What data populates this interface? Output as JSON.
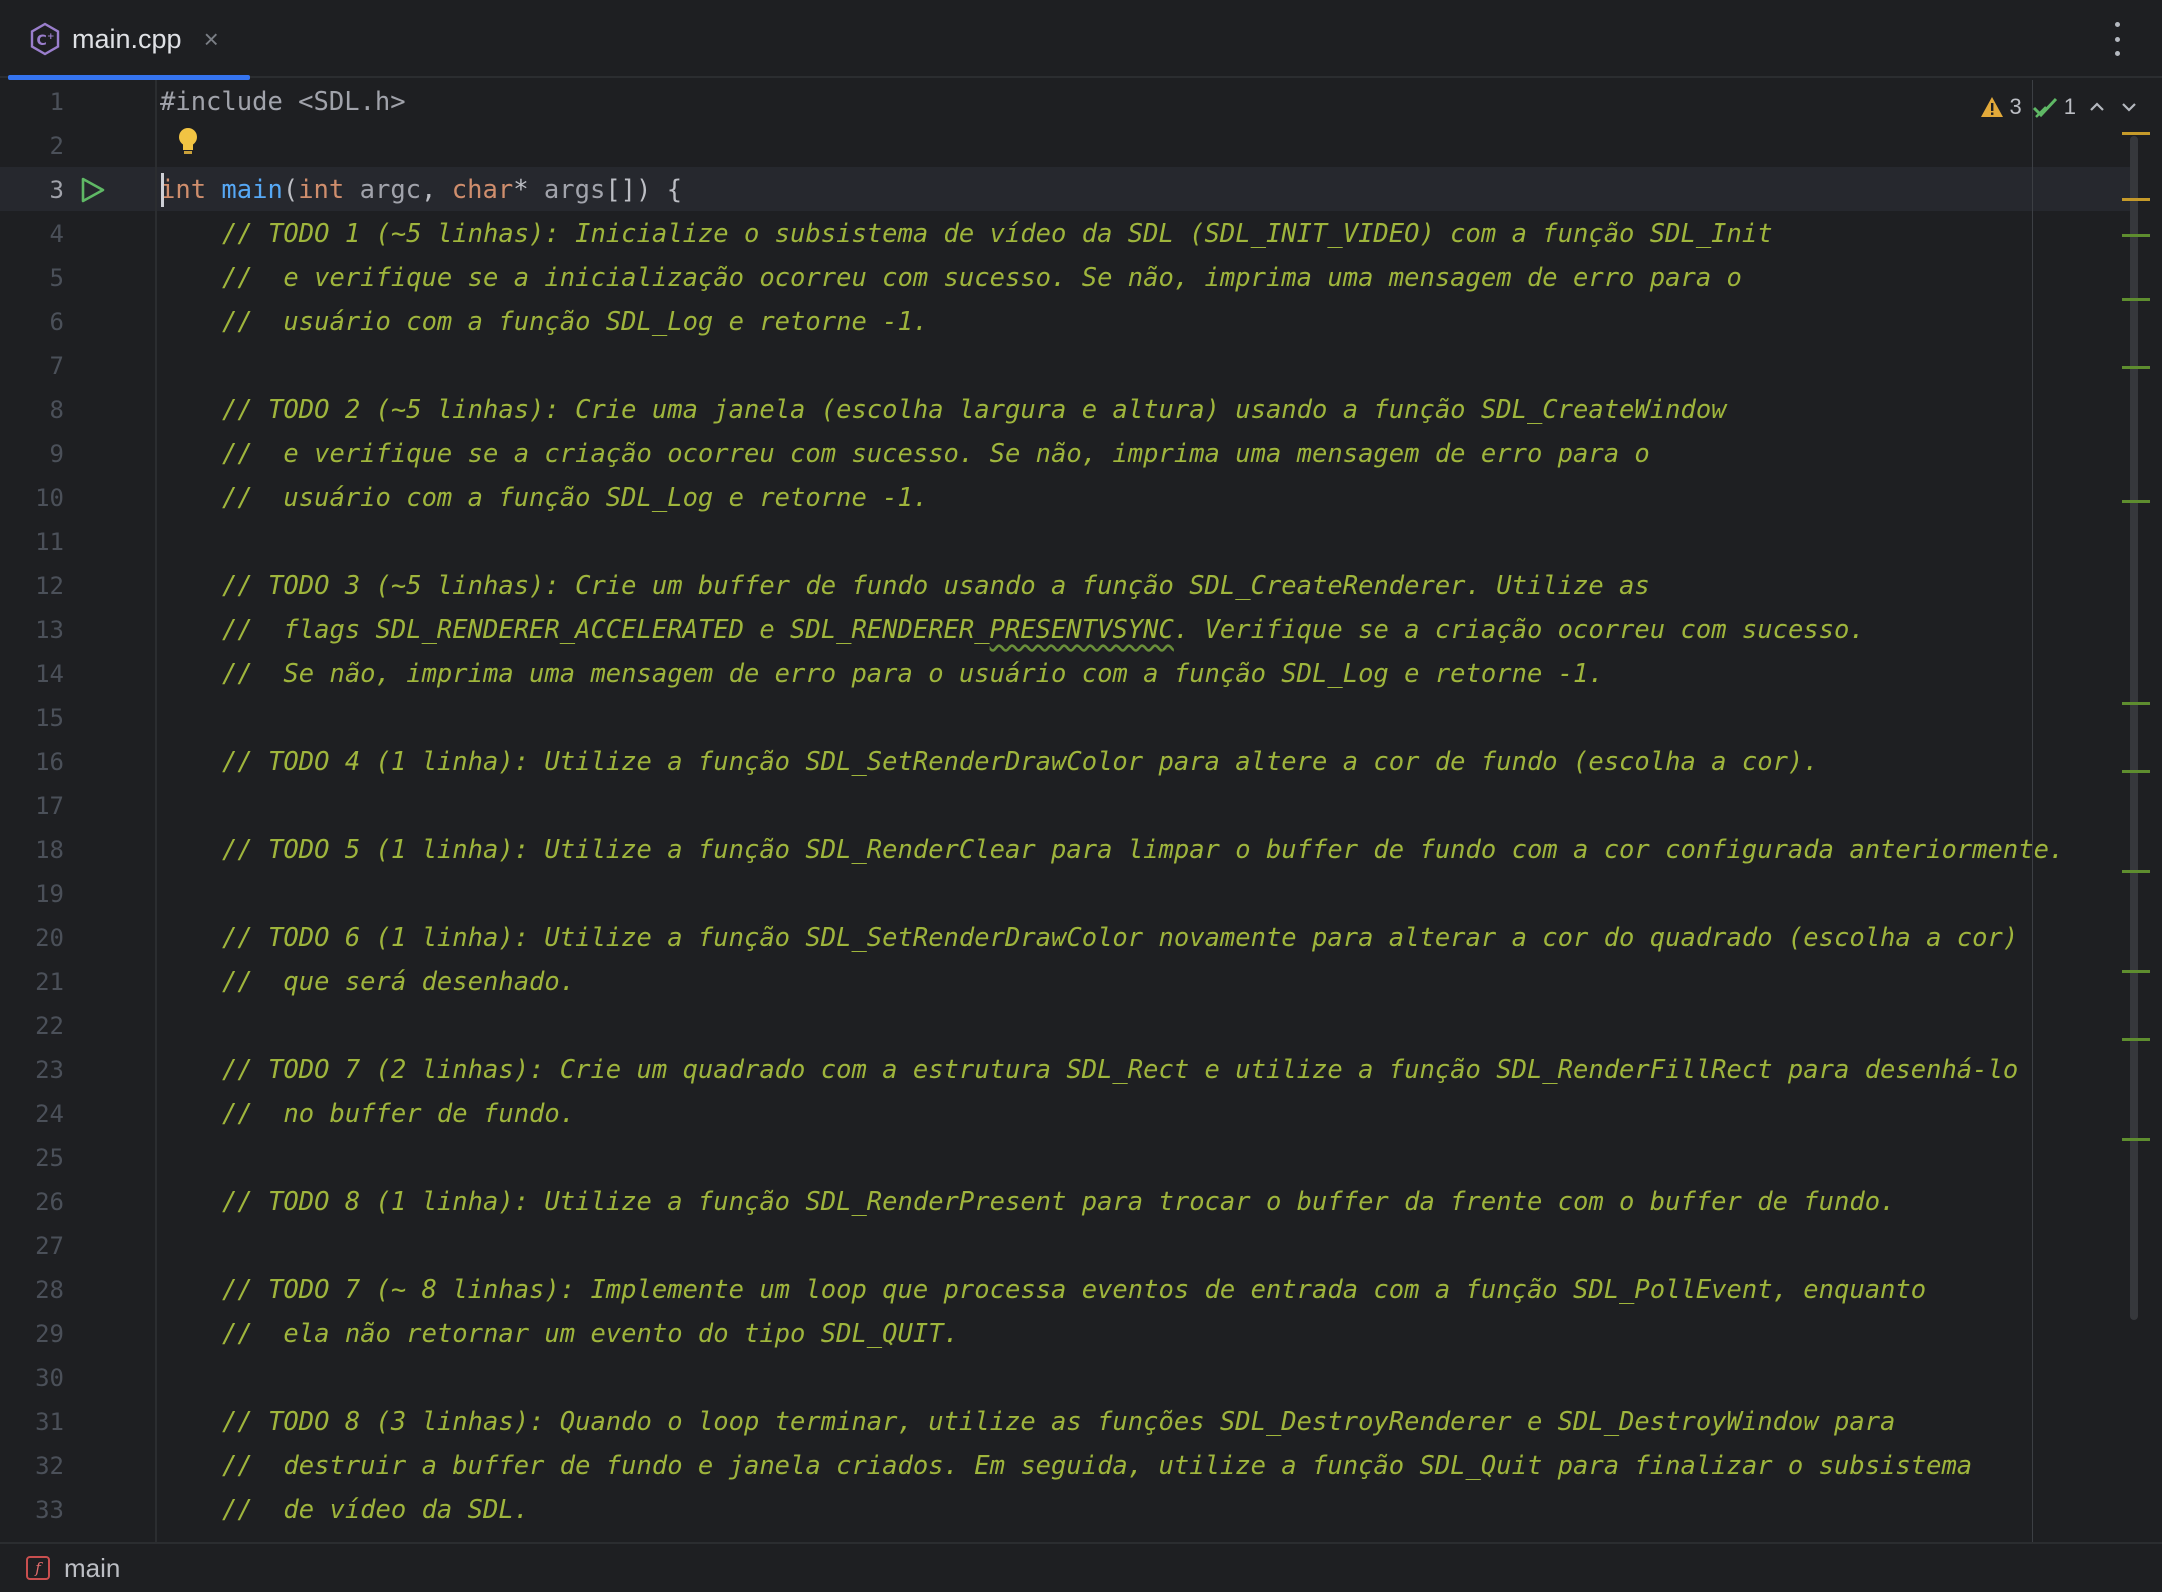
{
  "tab": {
    "filename": "main.cpp",
    "close": "×"
  },
  "inspections": {
    "warnings": "3",
    "weak_warnings": "1"
  },
  "code": {
    "l1": "#include <SDL.h>",
    "l3": {
      "kw_int": "int",
      "fn_main": "main",
      "paren_open": "(",
      "kw_int2": "int",
      "p_argc": "argc",
      "comma": ", ",
      "kw_char": "char",
      "star": "* ",
      "p_args": "args",
      "rest": "[]) {"
    },
    "l4": "// TODO 1 (~5 linhas): Inicialize o subsistema de vídeo da SDL (SDL_INIT_VIDEO) com a função SDL_Init",
    "l5": "//  e verifique se a inicialização ocorreu com sucesso. Se não, imprima uma mensagem de erro para o",
    "l6": "//  usuário com a função SDL_Log e retorne -1.",
    "l8": "// TODO 2 (~5 linhas): Crie uma janela (escolha largura e altura) usando a função SDL_CreateWindow",
    "l9": "//  e verifique se a criação ocorreu com sucesso. Se não, imprima uma mensagem de erro para o",
    "l10": "//  usuário com a função SDL_Log e retorne -1.",
    "l12": "// TODO 3 (~5 linhas): Crie um buffer de fundo usando a função SDL_CreateRenderer. Utilize as",
    "l13a": "//  flags SDL_RENDERER_ACCELERATED e SDL_RENDERER_",
    "l13b": "PRESENTVSYNC",
    "l13c": ". Verifique se a criação ocorreu com sucesso.",
    "l14": "//  Se não, imprima uma mensagem de erro para o usuário com a função SDL_Log e retorne -1.",
    "l16": "// TODO 4 (1 linha): Utilize a função SDL_SetRenderDrawColor para altere a cor de fundo (escolha a cor).",
    "l18": "// TODO 5 (1 linha): Utilize a função SDL_RenderClear para limpar o buffer de fundo com a cor configurada anteriormente.",
    "l20": "// TODO 6 (1 linha): Utilize a função SDL_SetRenderDrawColor novamente para alterar a cor do quadrado (escolha a cor)",
    "l21": "//  que será desenhado.",
    "l23": "// TODO 7 (2 linhas): Crie um quadrado com a estrutura SDL_Rect e utilize a função SDL_RenderFillRect para desenhá-lo",
    "l24": "//  no buffer de fundo.",
    "l26": "// TODO 8 (1 linha): Utilize a função SDL_RenderPresent para trocar o buffer da frente com o buffer de fundo.",
    "l28": "// TODO 7 (~ 8 linhas): Implemente um loop que processa eventos de entrada com a função SDL_PollEvent, enquanto",
    "l29": "//  ela não retornar um evento do tipo SDL_QUIT.",
    "l31": "// TODO 8 (3 linhas): Quando o loop terminar, utilize as funções SDL_DestroyRenderer e SDL_DestroyWindow para",
    "l32": "//  destruir a buffer de fundo e janela criados. Em seguida, utilize a função SDL_Quit para finalizar o subsistema",
    "l33": "//  de vídeo da SDL."
  },
  "line_numbers": [
    "1",
    "2",
    "3",
    "4",
    "5",
    "6",
    "7",
    "8",
    "9",
    "10",
    "11",
    "12",
    "13",
    "14",
    "15",
    "16",
    "17",
    "18",
    "19",
    "20",
    "21",
    "22",
    "23",
    "24",
    "25",
    "26",
    "27",
    "28",
    "29",
    "30",
    "31",
    "32",
    "33"
  ],
  "status": {
    "badge": "f",
    "breadcrumb": "main"
  },
  "colors": {
    "accent": "#3574f0",
    "comment": "#9fb53c",
    "keyword": "#cf8e6d",
    "function": "#56a8f5",
    "warning": "#c59a2a"
  }
}
